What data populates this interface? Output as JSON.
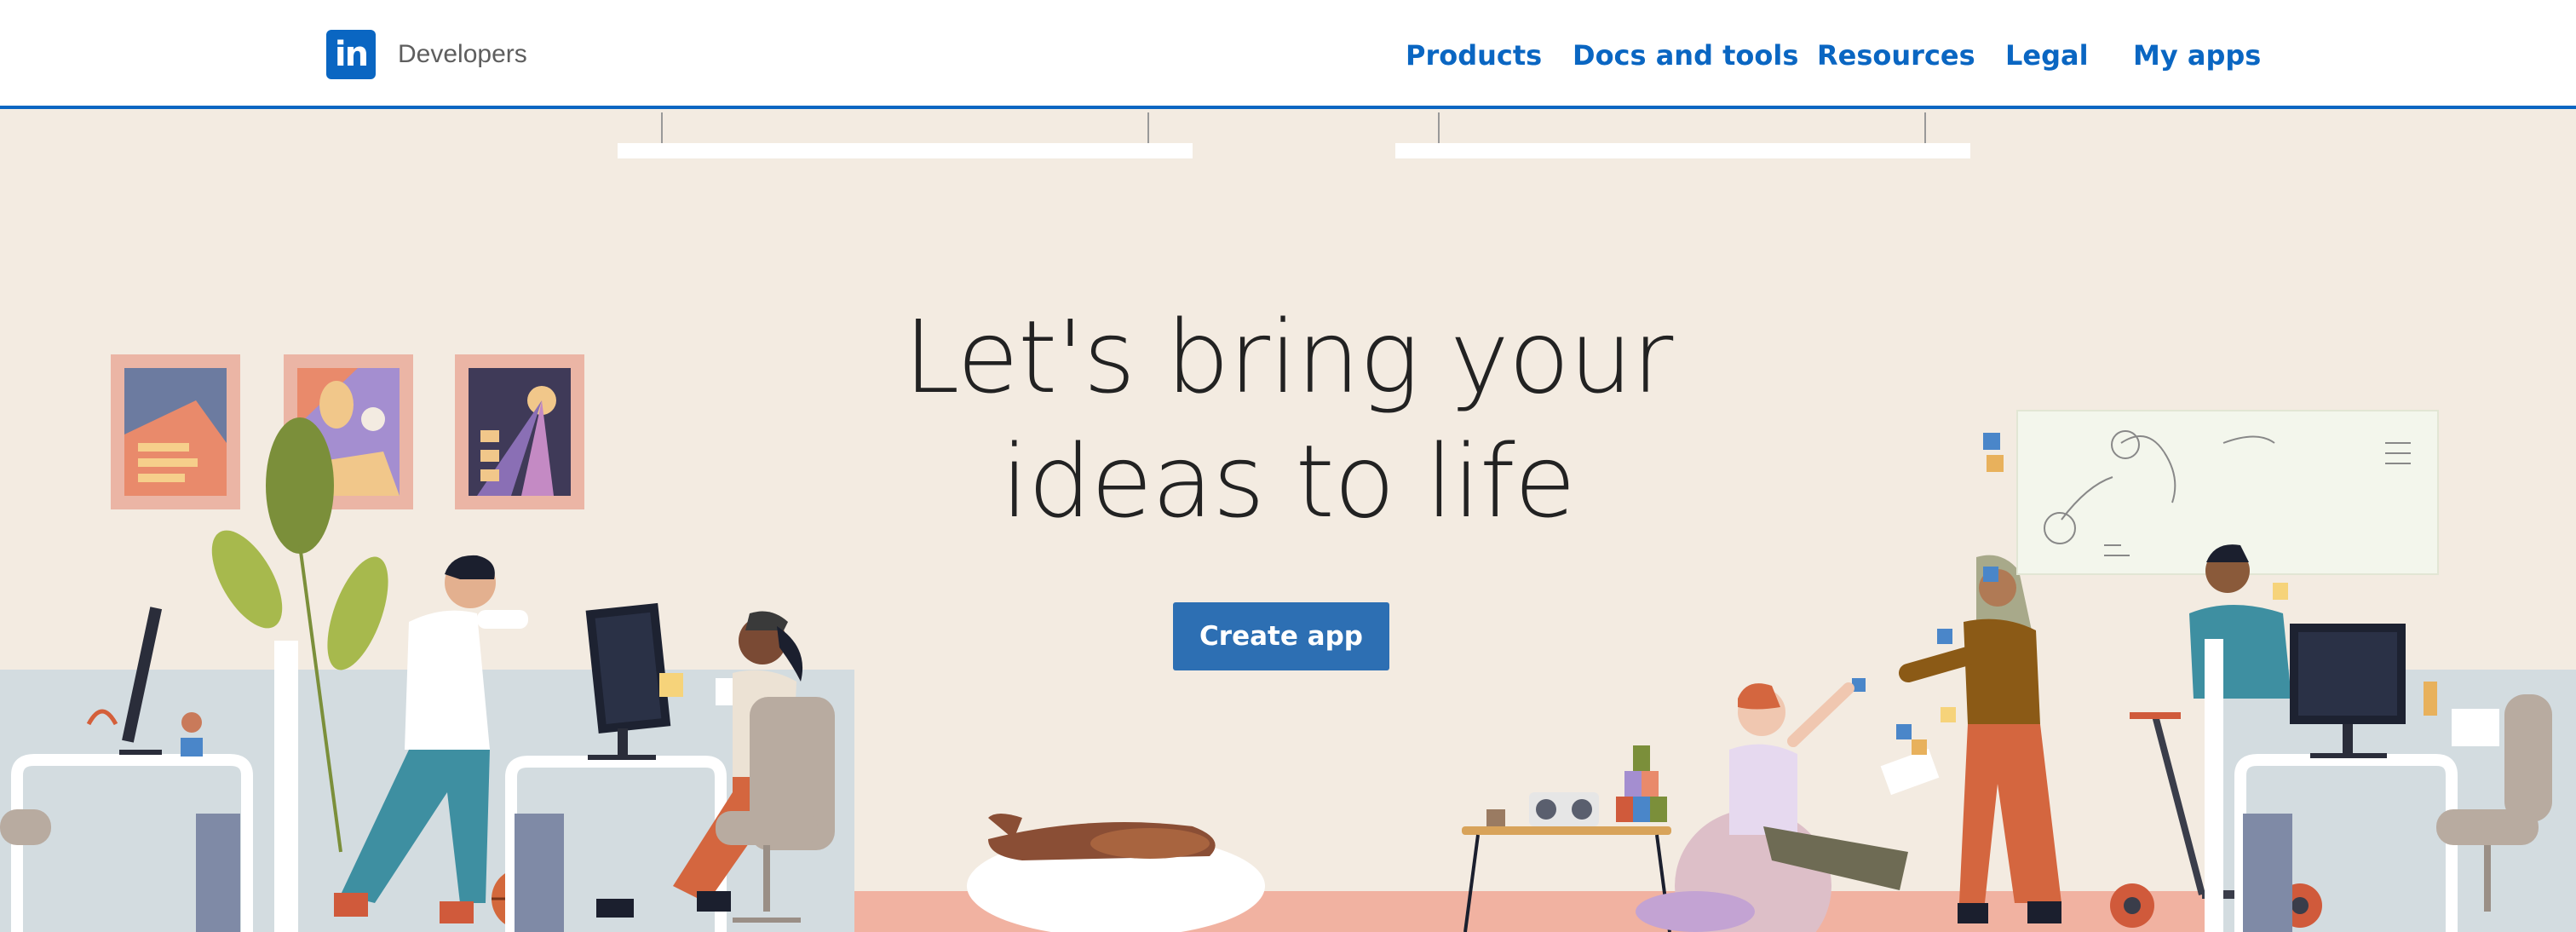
{
  "header": {
    "brand_logo_text": "in",
    "brand_label": "Developers",
    "nav": [
      {
        "label": "Products"
      },
      {
        "label": "Docs and tools"
      },
      {
        "label": "Resources"
      },
      {
        "label": "Legal"
      },
      {
        "label": "My apps"
      }
    ]
  },
  "hero": {
    "headline_line1": "Let's bring your",
    "headline_line2": "ideas to life",
    "cta_label": "Create app"
  },
  "colors": {
    "brand": "#0a66c2",
    "cta": "#2d6fb3",
    "background": "#f3ebe1"
  }
}
